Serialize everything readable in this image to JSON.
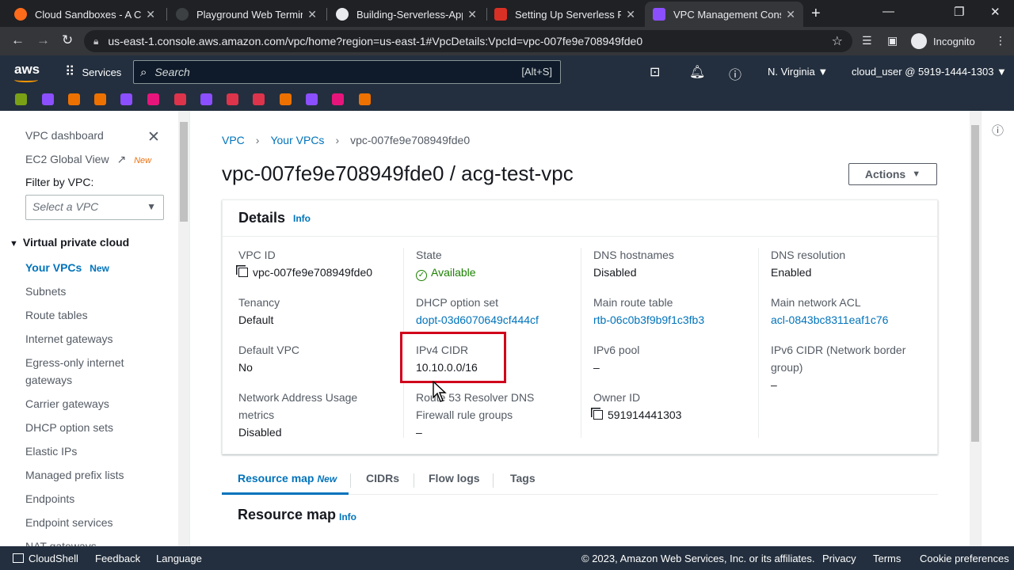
{
  "browser": {
    "tabs": [
      {
        "title": "Cloud Sandboxes - A Clou",
        "color": "#ff6b1a"
      },
      {
        "title": "Playground Web Terminal",
        "color": "#3c4043"
      },
      {
        "title": "Building-Serverless-Apps",
        "color": "#e8eaed"
      },
      {
        "title": "Setting Up Serverless Fran",
        "color": "#d93025"
      },
      {
        "title": "VPC Management Consol",
        "color": "#8c4fff"
      }
    ],
    "url": "us-east-1.console.aws.amazon.com/vpc/home?region=us-east-1#VpcDetails:VpcId=vpc-007fe9e708949fde0",
    "profile": "Incognito"
  },
  "aws_nav": {
    "logo": "aws",
    "services": "Services",
    "search_placeholder": "Search",
    "search_shortcut": "[Alt+S]",
    "region": "N. Virginia ▼",
    "account": "cloud_user @ 5919-1444-1303 ▼"
  },
  "favorite_colors": [
    "#7aa116",
    "#8c4fff",
    "#ed7100",
    "#ed7100",
    "#8c4fff",
    "#e7157b",
    "#dd344c",
    "#8c4fff",
    "#dd344c",
    "#dd344c",
    "#ed7100",
    "#8c4fff",
    "#e7157b",
    "#ed7100"
  ],
  "sidebar": {
    "dashboard": "VPC dashboard",
    "ec2_global": "EC2 Global View",
    "new_badge": "New",
    "filter_label": "Filter by VPC:",
    "filter_placeholder": "Select a VPC",
    "section": "Virtual private cloud",
    "items": [
      {
        "label": "Your VPCs",
        "badge": "New"
      },
      {
        "label": "Subnets"
      },
      {
        "label": "Route tables"
      },
      {
        "label": "Internet gateways"
      },
      {
        "label": "Egress-only internet"
      },
      {
        "label": "gateways"
      },
      {
        "label": "Carrier gateways"
      },
      {
        "label": "DHCP option sets"
      },
      {
        "label": "Elastic IPs"
      },
      {
        "label": "Managed prefix lists"
      },
      {
        "label": "Endpoints"
      },
      {
        "label": "Endpoint services"
      },
      {
        "label": "NAT gateways"
      }
    ]
  },
  "breadcrumb": [
    "VPC",
    "Your VPCs",
    "vpc-007fe9e708949fde0"
  ],
  "page_title": "vpc-007fe9e708949fde0 / acg-test-vpc",
  "actions_label": "Actions",
  "details": {
    "title": "Details",
    "info": "Info",
    "vpc_id_label": "VPC ID",
    "vpc_id": "vpc-007fe9e708949fde0",
    "state_label": "State",
    "state": "Available",
    "dns_hostnames_label": "DNS hostnames",
    "dns_hostnames": "Disabled",
    "dns_resolution_label": "DNS resolution",
    "dns_resolution": "Enabled",
    "tenancy_label": "Tenancy",
    "tenancy": "Default",
    "dhcp_label": "DHCP option set",
    "dhcp": "dopt-03d6070649cf444cf",
    "main_rt_label": "Main route table",
    "main_rt": "rtb-06c0b3f9b9f1c3fb3",
    "main_acl_label": "Main network ACL",
    "main_acl": "acl-0843bc8311eaf1c76",
    "default_vpc_label": "Default VPC",
    "default_vpc": "No",
    "ipv4_label": "IPv4 CIDR",
    "ipv4": "10.10.0.0/16",
    "ipv6_pool_label": "IPv6 pool",
    "ipv6_pool": "–",
    "ipv6_cidr_label_1": "IPv6 CIDR (Network border",
    "ipv6_cidr_label_2": "group)",
    "ipv6_cidr": "–",
    "nau_label_1": "Network Address Usage",
    "nau_label_2": "metrics",
    "nau": "Disabled",
    "r53_label_1": "Route 53 Resolver DNS",
    "r53_label_2": "Firewall rule groups",
    "r53": "–",
    "owner_label": "Owner ID",
    "owner": "591914441303"
  },
  "detail_tabs": {
    "resource_map": "Resource map",
    "new": "New",
    "cidrs": "CIDRs",
    "flow_logs": "Flow logs",
    "tags": "Tags"
  },
  "resource_map_title": "Resource map",
  "footer": {
    "cloudshell": "CloudShell",
    "feedback": "Feedback",
    "language": "Language",
    "copyright": "© 2023, Amazon Web Services, Inc. or its affiliates.",
    "privacy": "Privacy",
    "terms": "Terms",
    "cookie": "Cookie preferences"
  }
}
